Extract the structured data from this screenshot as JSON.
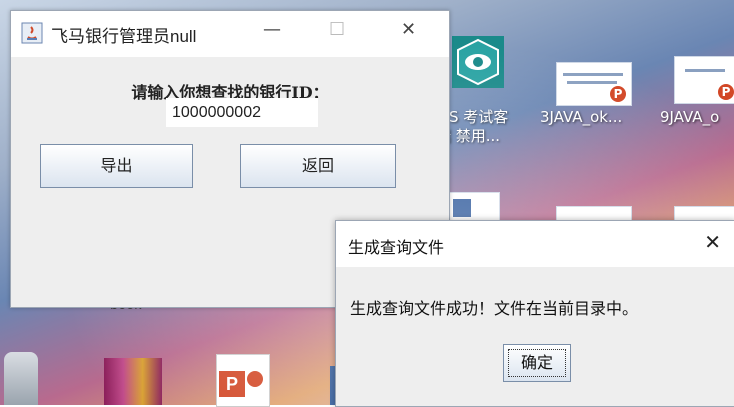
{
  "main_window": {
    "title": "飞马银行管理员null",
    "minimize": "—",
    "maximize": "☐",
    "close": "✕",
    "prompt": "请输入你想查找的银行ID：",
    "id_value": "1000000002",
    "export_label": "导出",
    "back_label": "返回"
  },
  "dialog": {
    "title": "生成查询文件",
    "close": "✕",
    "message": "生成查询文件成功！文件在当前目录中。",
    "ok_label": "确定"
  },
  "desktop": {
    "icons": [
      {
        "label_line1": "MS 考试客",
        "label_line2": "端 禁用..."
      },
      {
        "label_line1": "3JAVA_ok..."
      },
      {
        "label_line1": "9JAVA_o"
      }
    ],
    "partial_text": "book"
  },
  "colors": {
    "ppt_badge": "#d24726",
    "exam_icon": "#1a8a8a",
    "button_border": "#7a8ea8"
  }
}
